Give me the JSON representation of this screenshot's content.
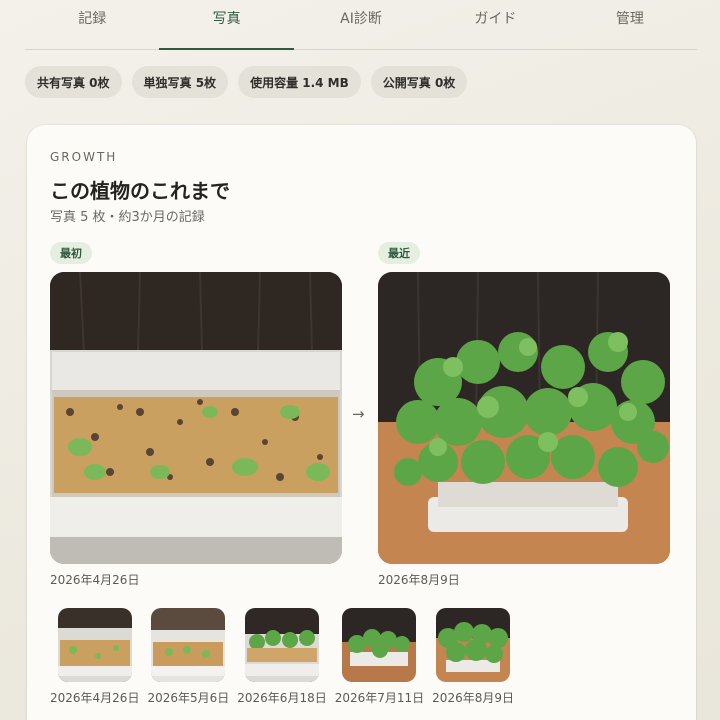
{
  "tabs": [
    {
      "label": "記録",
      "active": false
    },
    {
      "label": "写真",
      "active": true
    },
    {
      "label": "AI診断",
      "active": false
    },
    {
      "label": "ガイド",
      "active": false
    },
    {
      "label": "管理",
      "active": false
    }
  ],
  "stats": [
    "共有写真 0枚",
    "単独写真 5枚",
    "使用容量 1.4 MB",
    "公開写真 0枚"
  ],
  "growth": {
    "eyebrow": "GROWTH",
    "title": "この植物のこれまで",
    "subtitle": "写真 5 枚・約3か月の記録",
    "first_label": "最初",
    "latest_label": "最近",
    "first_date": "2026年4月26日",
    "latest_date": "2026年8月9日",
    "arrow": "→"
  },
  "timeline": [
    {
      "date": "2026年4月26日"
    },
    {
      "date": "2026年5月6日"
    },
    {
      "date": "2026年6月18日"
    },
    {
      "date": "2026年7月11日"
    },
    {
      "date": "2026年8月9日"
    }
  ],
  "colors": {
    "accent": "#2f5a40",
    "badge_bg": "#e4efe2",
    "chip_bg": "#e4e1d8",
    "card_bg": "#fdfbf7"
  }
}
